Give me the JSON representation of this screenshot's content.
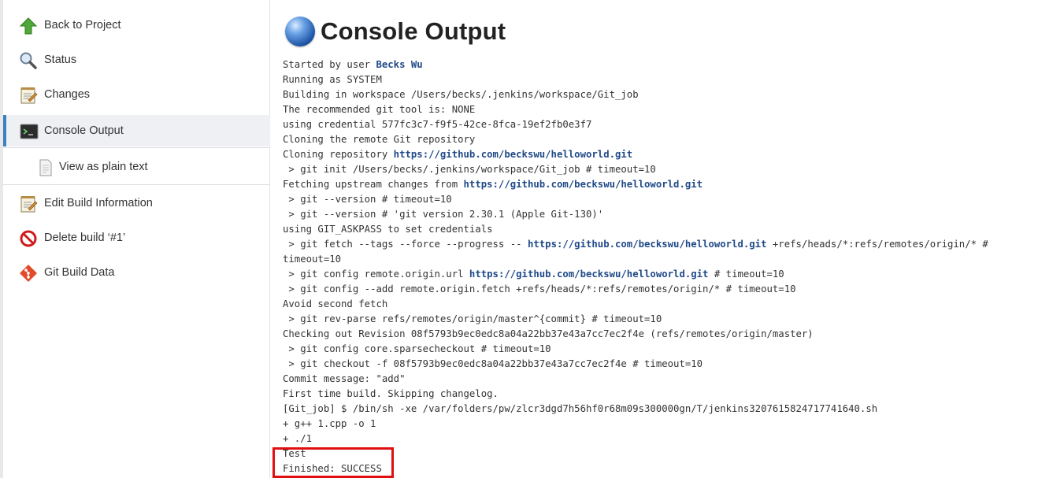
{
  "sidebar": {
    "back_to_project": "Back to Project",
    "status": "Status",
    "changes": "Changes",
    "console_output": "Console Output",
    "view_as_plain_text": "View as plain text",
    "edit_build_information": "Edit Build Information",
    "delete_build": "Delete build ‘#1’",
    "git_build_data": "Git Build Data"
  },
  "main": {
    "title": "Console Output"
  },
  "console": {
    "l01a": "Started by user ",
    "l01_user": "Becks Wu",
    "l02": "Running as SYSTEM",
    "l03": "Building in workspace /Users/becks/.jenkins/workspace/Git_job",
    "l04": "The recommended git tool is: NONE",
    "l05": "using credential 577fc3c7-f9f5-42ce-8fca-19ef2fb0e3f7",
    "l06": "Cloning the remote Git repository",
    "l07a": "Cloning repository ",
    "l07_link": "https://github.com/beckswu/helloworld.git",
    "l08": " > git init /Users/becks/.jenkins/workspace/Git_job # timeout=10",
    "l09a": "Fetching upstream changes from ",
    "l09_link": "https://github.com/beckswu/helloworld.git",
    "l10": " > git --version # timeout=10",
    "l11": " > git --version # 'git version 2.30.1 (Apple Git-130)'",
    "l12": "using GIT_ASKPASS to set credentials",
    "l13a": " > git fetch --tags --force --progress -- ",
    "l13_link": "https://github.com/beckswu/helloworld.git",
    "l13b": " +refs/heads/*:refs/remotes/origin/* #",
    "l14": "timeout=10",
    "l15a": " > git config remote.origin.url ",
    "l15_link": "https://github.com/beckswu/helloworld.git",
    "l15b": " # timeout=10",
    "l16": " > git config --add remote.origin.fetch +refs/heads/*:refs/remotes/origin/* # timeout=10",
    "l17": "Avoid second fetch",
    "l18": " > git rev-parse refs/remotes/origin/master^{commit} # timeout=10",
    "l19": "Checking out Revision 08f5793b9ec0edc8a04a22bb37e43a7cc7ec2f4e (refs/remotes/origin/master)",
    "l20": " > git config core.sparsecheckout # timeout=10",
    "l21": " > git checkout -f 08f5793b9ec0edc8a04a22bb37e43a7cc7ec2f4e # timeout=10",
    "l22": "Commit message: \"add\"",
    "l23": "First time build. Skipping changelog.",
    "l24": "[Git_job] $ /bin/sh -xe /var/folders/pw/zlcr3dgd7h56hf0r68m09s300000gn/T/jenkins3207615824717741640.sh",
    "l25": "+ g++ 1.cpp -o 1",
    "l26": "+ ./1",
    "l27": "Test",
    "l28": "Finished: SUCCESS"
  },
  "colors": {
    "link": "#204a87",
    "highlight": "#e01010",
    "active_bar": "#3b81c2"
  }
}
